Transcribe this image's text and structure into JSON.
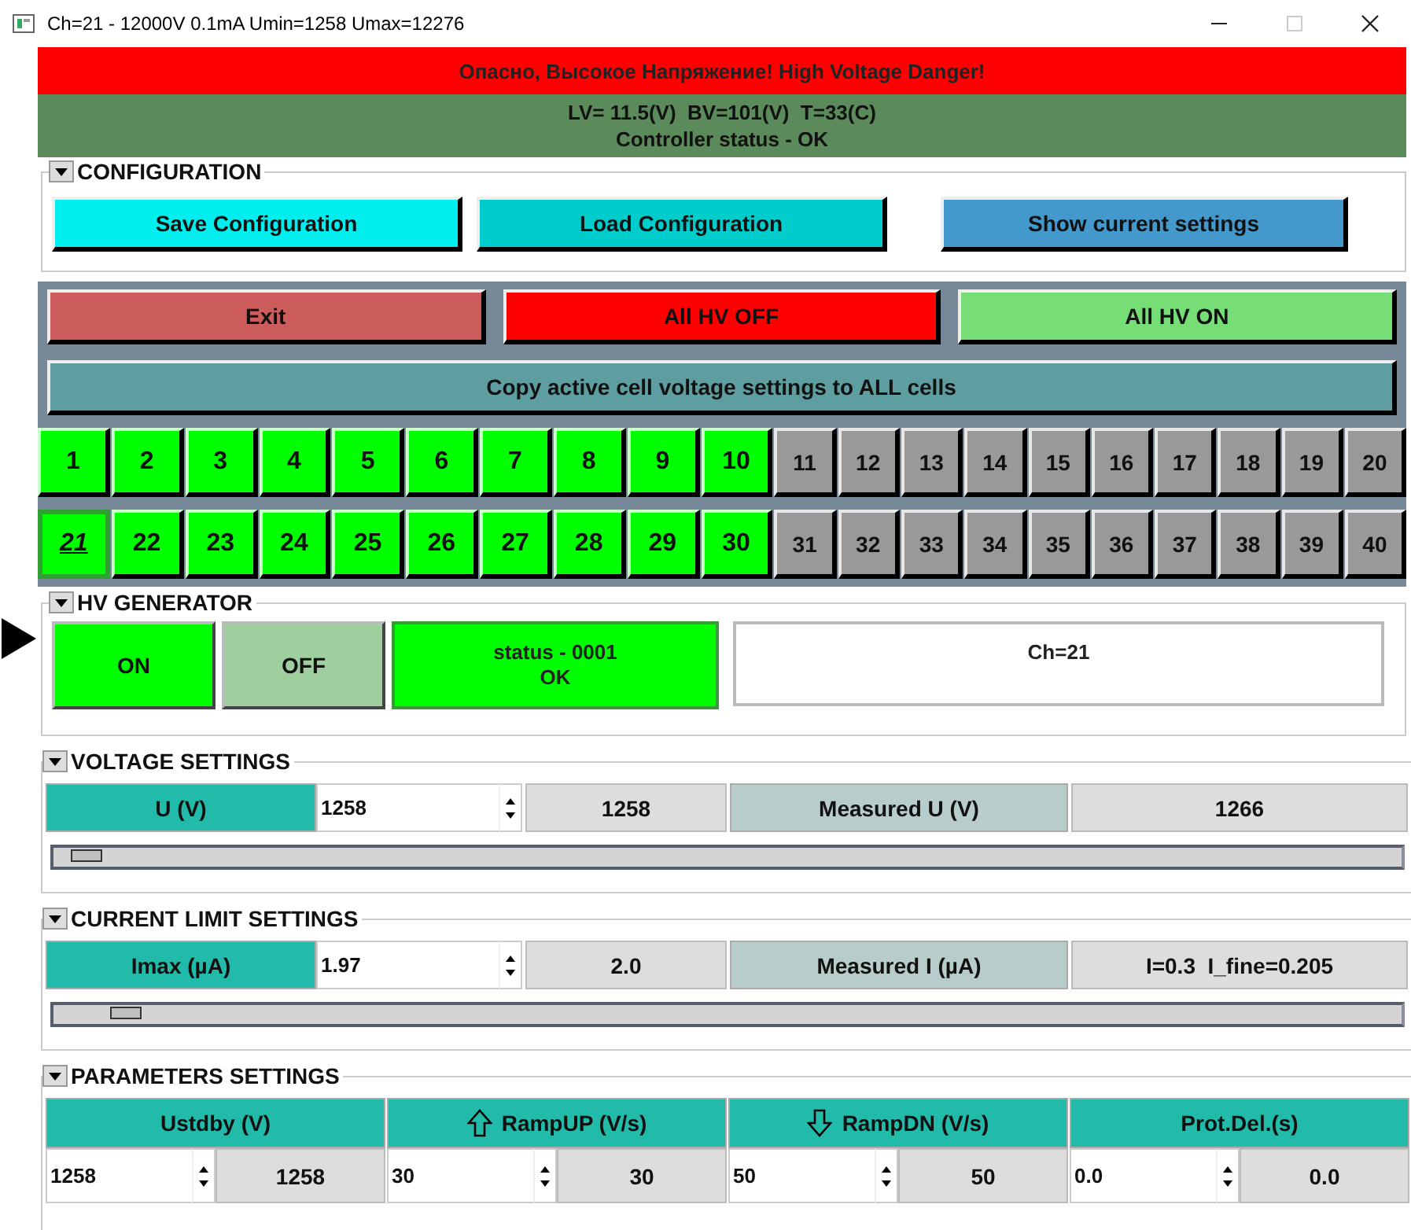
{
  "window": {
    "title": "Ch=21 - 12000V 0.1mA Umin=1258 Umax=12276"
  },
  "banner": "Опасно, Высокое Напряжение! High Voltage Danger!",
  "status_lines": [
    "LV= 11.5(V)  BV=101(V)  T=33(C)",
    "Controller status - OK"
  ],
  "configuration": {
    "title": "CONFIGURATION",
    "buttons": [
      "Save Configuration",
      "Load Configuration",
      "Show current settings"
    ]
  },
  "controls": {
    "buttons": [
      "Exit",
      "All HV OFF",
      "All HV ON"
    ],
    "copy_button": "Copy active cell voltage settings to ALL cells"
  },
  "channels": [
    {
      "label": "1",
      "on": true,
      "selected": false
    },
    {
      "label": "2",
      "on": true,
      "selected": false
    },
    {
      "label": "3",
      "on": true,
      "selected": false
    },
    {
      "label": "4",
      "on": true,
      "selected": false
    },
    {
      "label": "5",
      "on": true,
      "selected": false
    },
    {
      "label": "6",
      "on": true,
      "selected": false
    },
    {
      "label": "7",
      "on": true,
      "selected": false
    },
    {
      "label": "8",
      "on": true,
      "selected": false
    },
    {
      "label": "9",
      "on": true,
      "selected": false
    },
    {
      "label": "10",
      "on": true,
      "selected": false
    },
    {
      "label": "11",
      "on": false,
      "selected": false
    },
    {
      "label": "12",
      "on": false,
      "selected": false
    },
    {
      "label": "13",
      "on": false,
      "selected": false
    },
    {
      "label": "14",
      "on": false,
      "selected": false
    },
    {
      "label": "15",
      "on": false,
      "selected": false
    },
    {
      "label": "16",
      "on": false,
      "selected": false
    },
    {
      "label": "17",
      "on": false,
      "selected": false
    },
    {
      "label": "18",
      "on": false,
      "selected": false
    },
    {
      "label": "19",
      "on": false,
      "selected": false
    },
    {
      "label": "20",
      "on": false,
      "selected": false
    },
    {
      "label": "21",
      "on": true,
      "selected": true
    },
    {
      "label": "22",
      "on": true,
      "selected": false
    },
    {
      "label": "23",
      "on": true,
      "selected": false
    },
    {
      "label": "24",
      "on": true,
      "selected": false
    },
    {
      "label": "25",
      "on": true,
      "selected": false
    },
    {
      "label": "26",
      "on": true,
      "selected": false
    },
    {
      "label": "27",
      "on": true,
      "selected": false
    },
    {
      "label": "28",
      "on": true,
      "selected": false
    },
    {
      "label": "29",
      "on": true,
      "selected": false
    },
    {
      "label": "30",
      "on": true,
      "selected": false
    },
    {
      "label": "31",
      "on": false,
      "selected": false
    },
    {
      "label": "32",
      "on": false,
      "selected": false
    },
    {
      "label": "33",
      "on": false,
      "selected": false
    },
    {
      "label": "34",
      "on": false,
      "selected": false
    },
    {
      "label": "35",
      "on": false,
      "selected": false
    },
    {
      "label": "36",
      "on": false,
      "selected": false
    },
    {
      "label": "37",
      "on": false,
      "selected": false
    },
    {
      "label": "38",
      "on": false,
      "selected": false
    },
    {
      "label": "39",
      "on": false,
      "selected": false
    },
    {
      "label": "40",
      "on": false,
      "selected": false
    }
  ],
  "hv_generator": {
    "title": "HV GENERATOR",
    "on": true,
    "on_label": "ON",
    "off_label": "OFF",
    "status_ok": true,
    "status_lines": [
      "status - 0001",
      "OK"
    ],
    "info": "Ch=21"
  },
  "voltage": {
    "title": "VOLTAGE SETTINGS",
    "label": "U (V)",
    "value": "1258",
    "set": "1258",
    "measured_label": "Measured U (V)",
    "measured": "1266",
    "level": 0.01
  },
  "current": {
    "title": "CURRENT LIMIT SETTINGS",
    "label": "Imax (µA)",
    "value": "1.97",
    "set": "2.0",
    "measured_label": "Measured I (µA)",
    "measured": "I=0.3  I_fine=0.205",
    "level": 0.04
  },
  "parameters": {
    "title": "PARAMETERS SETTINGS",
    "columns": [
      {
        "label": "Ustdby (V)",
        "kind": "plain",
        "value": "1258",
        "set": "1258"
      },
      {
        "label": "RampUP (V/s)",
        "kind": "up",
        "value": "30",
        "set": "30"
      },
      {
        "label": "RampDN (V/s)",
        "kind": "down",
        "value": "50",
        "set": "50"
      },
      {
        "label": "Prot.Del.(s)",
        "kind": "plain",
        "value": "0.0",
        "set": "0.0"
      }
    ]
  }
}
